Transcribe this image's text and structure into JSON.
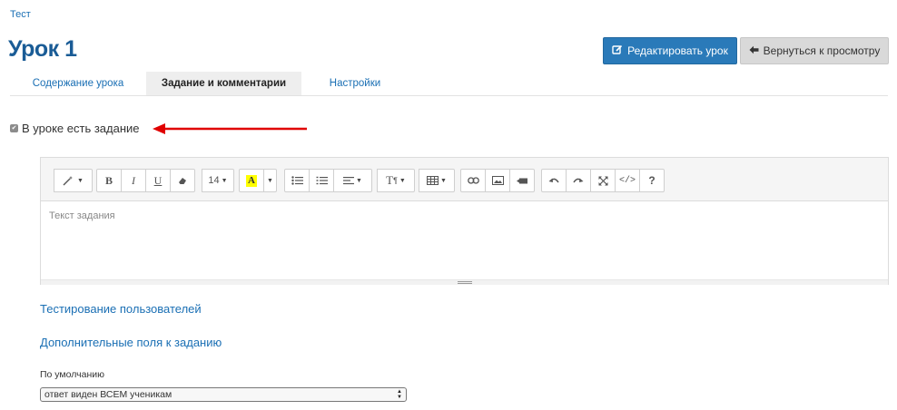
{
  "breadcrumb": "Тест",
  "page_title": "Урок 1",
  "buttons": {
    "edit": "Редактировать урок",
    "back": "Вернуться к просмотру"
  },
  "tabs": [
    {
      "label": "Содержание урока",
      "active": false
    },
    {
      "label": "Задание и комментарии",
      "active": true
    },
    {
      "label": "Настройки",
      "active": false
    }
  ],
  "has_task": {
    "label": "В уроке есть задание",
    "checked": true
  },
  "editor": {
    "placeholder": "Текст задания",
    "font_size": "14",
    "toolbar_icons": [
      "magic-wand-icon",
      "bold-icon",
      "italic-icon",
      "underline-icon",
      "eraser-icon",
      "font-size-dropdown",
      "highlight-icon",
      "unordered-list-icon",
      "ordered-list-icon",
      "align-icon",
      "text-style-icon",
      "table-icon",
      "link-icon",
      "image-icon",
      "video-icon",
      "undo-icon",
      "redo-icon",
      "fullscreen-icon",
      "code-view-icon",
      "help-icon"
    ]
  },
  "links": {
    "user_testing": "Тестирование пользователей",
    "extra_fields": "Дополнительные поля к заданию"
  },
  "visibility": {
    "label": "По умолчанию",
    "selected": "ответ виден ВСЕМ ученикам"
  },
  "colors": {
    "accent": "#2a7ab9",
    "title": "#1a5c96",
    "link": "#1a6fb4",
    "arrow": "#e00000",
    "highlight": "#ffff00"
  }
}
